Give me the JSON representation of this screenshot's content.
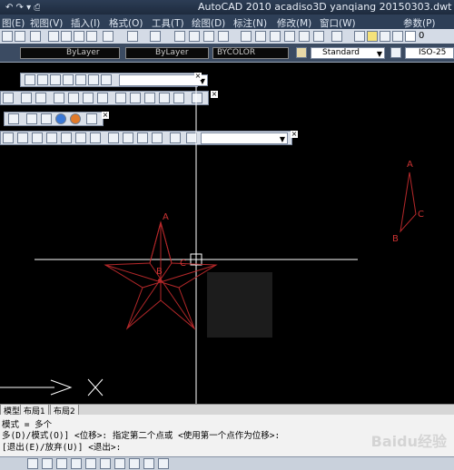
{
  "window": {
    "title": "AutoCAD 2010    acadiso3D   yanqiang 20150303.dwt"
  },
  "menu": {
    "items": [
      "图(E)",
      "视图(V)",
      "插入(I)",
      "格式(O)",
      "工具(T)",
      "绘图(D)",
      "标注(N)",
      "修改(M)",
      "窗口(W)",
      "参数(P)"
    ]
  },
  "properties": {
    "linetype": "ByLayer",
    "lineweight": "ByLayer",
    "color": "BYCOLOR",
    "text_style": "Standard",
    "dim_style": "ISO-25",
    "layer_num": "0"
  },
  "canvas": {
    "star_labels": {
      "a": "A",
      "b": "B",
      "c": "C"
    },
    "triangle_labels": {
      "a": "A",
      "b": "B",
      "c": "C"
    },
    "colors": {
      "geometry": "#b5282a",
      "crosshair": "#ffffff",
      "background": "#000000"
    }
  },
  "tabs": [
    "模型",
    "布局1",
    "布局2"
  ],
  "command": {
    "lines": [
      "模式 = 多个",
      "多(D)/模式(O)] <位移>: 指定第二个点或 <使用第一个点作为位移>:",
      "[退出(E)/放弃(U)] <退出>:"
    ]
  },
  "watermark": "Baidu经验"
}
